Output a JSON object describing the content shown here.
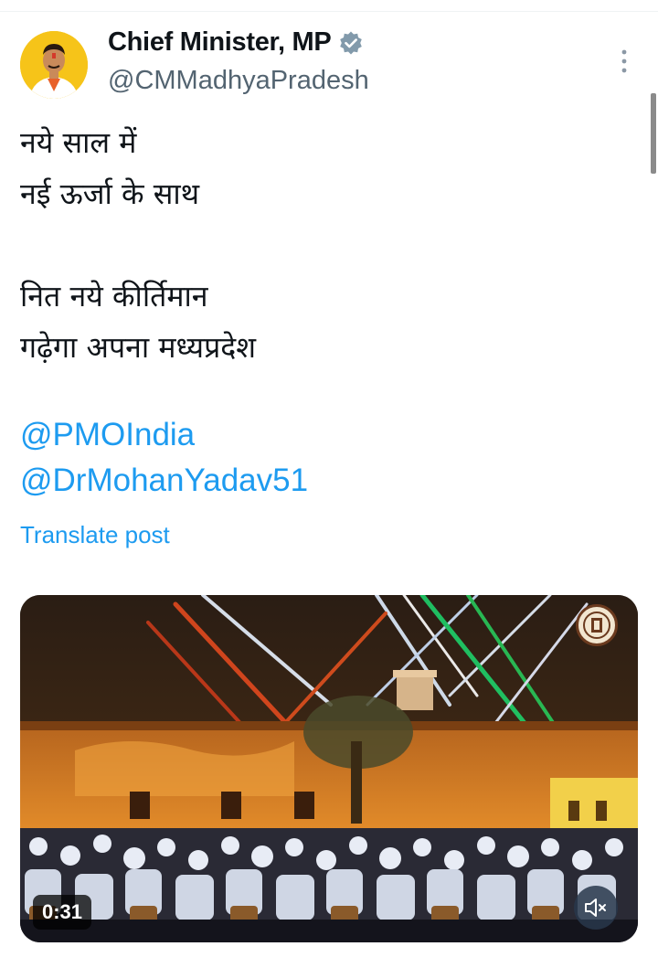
{
  "post": {
    "author_name": "Chief Minister, MP",
    "author_handle": "@CMMadhyaPradesh",
    "verified_icon": "verified-badge-icon",
    "more_icon": "more-vertical-icon",
    "text_lines": [
      "नये साल में",
      "नई ऊर्जा के साथ",
      "",
      "नित नये कीर्तिमान",
      "गढ़ेगा अपना मध्यप्रदेश"
    ],
    "mentions": [
      "@PMOIndia",
      "@DrMohanYadav51"
    ],
    "translate_label": "Translate post"
  },
  "video": {
    "duration": "0:31",
    "mute_icon": "speaker-muted-icon",
    "logo_icon": "government-emblem-icon"
  },
  "colors": {
    "link": "#1d9bf0",
    "secondary_text": "#536471",
    "verified": "#829aab"
  }
}
